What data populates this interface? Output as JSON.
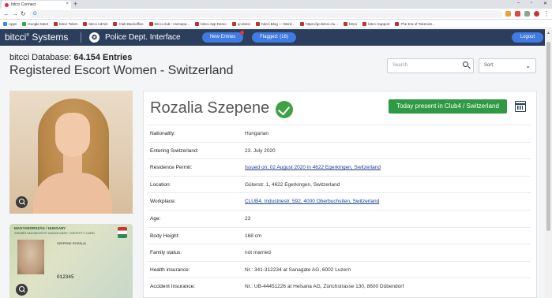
{
  "browser": {
    "tab_title": "bitcci Connect",
    "new_tab": "+",
    "close": "×",
    "omnibox_value": "G",
    "bookmarks": [
      "Apps",
      "Google Meet",
      "bitcci Token",
      "bitcci Admin",
      "Club Backoffice",
      "bitcci.club - Homepa...",
      "bitcci App Demo",
      "go.bitcci",
      "bitcci Blog — Word...",
      "https://go.bitcci.clu...",
      "bitcci",
      "bitcci Support",
      "The Era of Tokenize..."
    ]
  },
  "header": {
    "logo": "bitcci",
    "logo_sup": "®",
    "logo_rest": " Systems",
    "badge": "✪",
    "title": "Police Dept. Interface",
    "new_entries": "New Entries",
    "flagged": "Flagged: (16)",
    "logout": "Logout"
  },
  "main": {
    "db_prefix": "bitcci Database: ",
    "db_count": "64.154 Entries",
    "page_title": "Registered Escort Women - Switzerland",
    "search_placeholder": "Search",
    "sort_label": "Sort:"
  },
  "id_card": {
    "header": "MAGYARORSZÁG / HUNGARY",
    "subheader": "SZEMÉLYAZONOSÍTÓ IGAZOLVÁNY / IDENTITY CARD",
    "name_line": "SZEPENE ROZÁLIA",
    "number": "012345"
  },
  "profile": {
    "name": "Rozalia Szepene",
    "present_button": "Today present in Club4 / Switzerland",
    "rows": [
      {
        "label": "Nationality:",
        "value": "Hungarian",
        "link": false
      },
      {
        "label": "Entering Switzerland:",
        "value": "23. July 2020",
        "link": false
      },
      {
        "label": "Residence Permit:",
        "value": "Issued on: 02 August 2020 in 4622 Egerkingen, Switzerland",
        "link": true
      },
      {
        "label": "Location:",
        "value": "Güterstr. 1, 4622 Egerkingen, Switzerland",
        "link": false
      },
      {
        "label": "Workplace:",
        "value": "CLUB4, Industriestr. 592, 4000 Oberbuchsiten, Switzerland",
        "link": true
      },
      {
        "label": "Age:",
        "value": "23",
        "link": false
      },
      {
        "label": "Body Height:",
        "value": "168 cm",
        "link": false
      },
      {
        "label": "Family status:",
        "value": "not married",
        "link": false
      },
      {
        "label": "Health insurance:",
        "value": "Nr.: 341-312234 at Sanagate AG, 6002 Luzern",
        "link": false
      },
      {
        "label": "Accident Insurance:",
        "value": "Nr.: UB-44451226 at Helsana AG, Zürichstrasse 130, 8600 Dübendorf",
        "link": false
      }
    ]
  },
  "colors": {
    "header_bg": "#2b3e5b",
    "button_blue": "#3f7be0",
    "present_green": "#2f9a43",
    "verified_green": "#3fa046"
  }
}
